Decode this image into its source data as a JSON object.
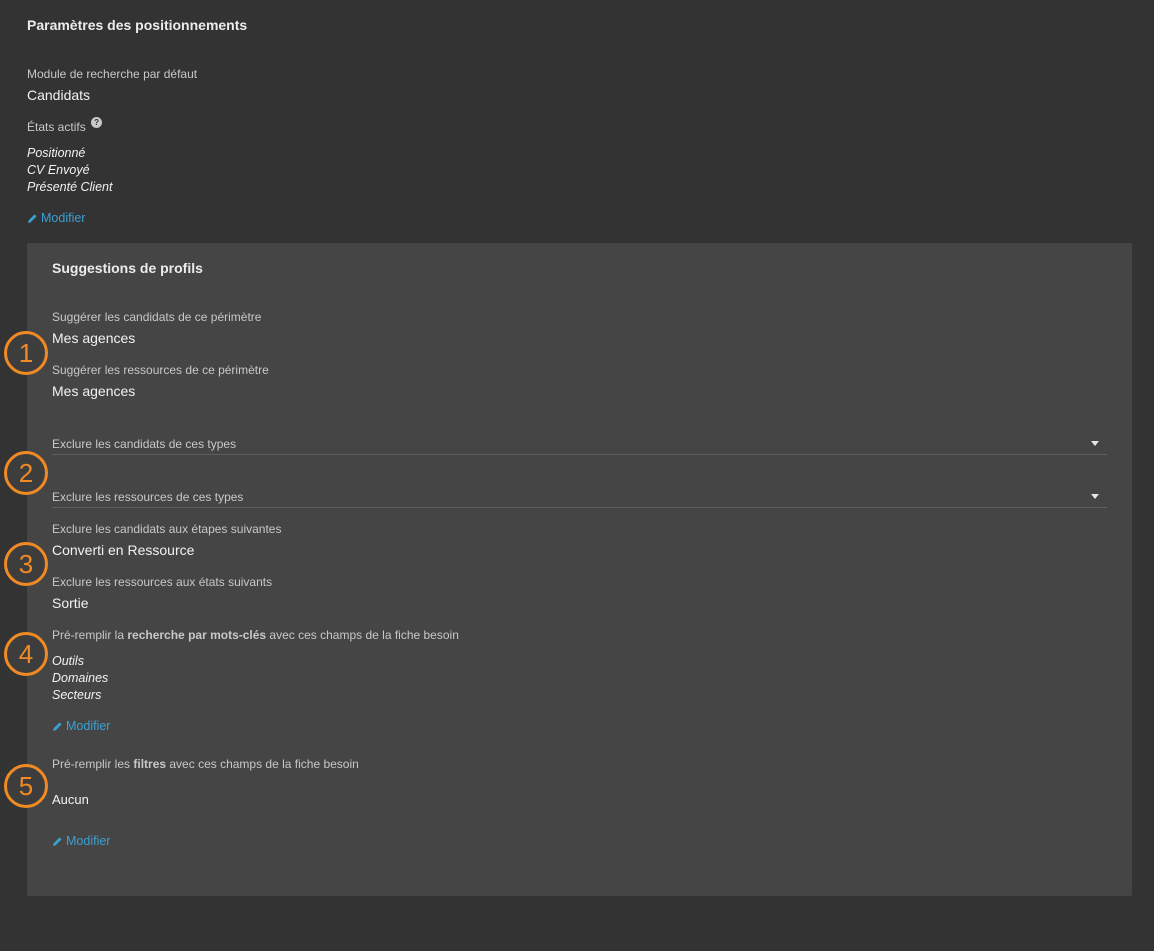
{
  "section": {
    "title": "Paramètres des positionnements",
    "default_module_label": "Module de recherche par défaut",
    "default_module_value": "Candidats",
    "active_states_label": "États actifs",
    "help_glyph": "?",
    "active_states": [
      "Positionné",
      "CV Envoyé",
      "Présenté Client"
    ],
    "modify_label": "Modifier"
  },
  "suggestions": {
    "title": "Suggestions de profils",
    "candidates_scope_label": "Suggérer les candidats de ce périmètre",
    "candidates_scope_value": "Mes agences",
    "resources_scope_label": "Suggérer les ressources de ce périmètre",
    "resources_scope_value": "Mes agences",
    "exclude_candidate_types_placeholder": "Exclure les candidats de ces types",
    "exclude_resource_types_placeholder": "Exclure les ressources de ces types",
    "exclude_candidate_steps_label": "Exclure les candidats aux étapes suivantes",
    "exclude_candidate_steps_value": "Converti en Ressource",
    "exclude_resource_states_label": "Exclure les ressources aux états suivants",
    "exclude_resource_states_value": "Sortie",
    "keywords_label_pre": "Pré-remplir la ",
    "keywords_label_bold": "recherche par mots-clés",
    "keywords_label_post": " avec ces champs de la fiche besoin",
    "keywords_fields": [
      "Outils",
      "Domaines",
      "Secteurs"
    ],
    "keywords_modify_label": "Modifier",
    "filters_label_pre": "Pré-remplir les ",
    "filters_label_bold": "filtres",
    "filters_label_post": " avec ces champs de la fiche besoin",
    "filters_value": "Aucun",
    "filters_modify_label": "Modifier"
  },
  "annotations": [
    "1",
    "2",
    "3",
    "4",
    "5"
  ],
  "colors": {
    "background": "#333333",
    "panel": "#454545",
    "link": "#3aa0d2",
    "annotation": "#f08a24"
  }
}
